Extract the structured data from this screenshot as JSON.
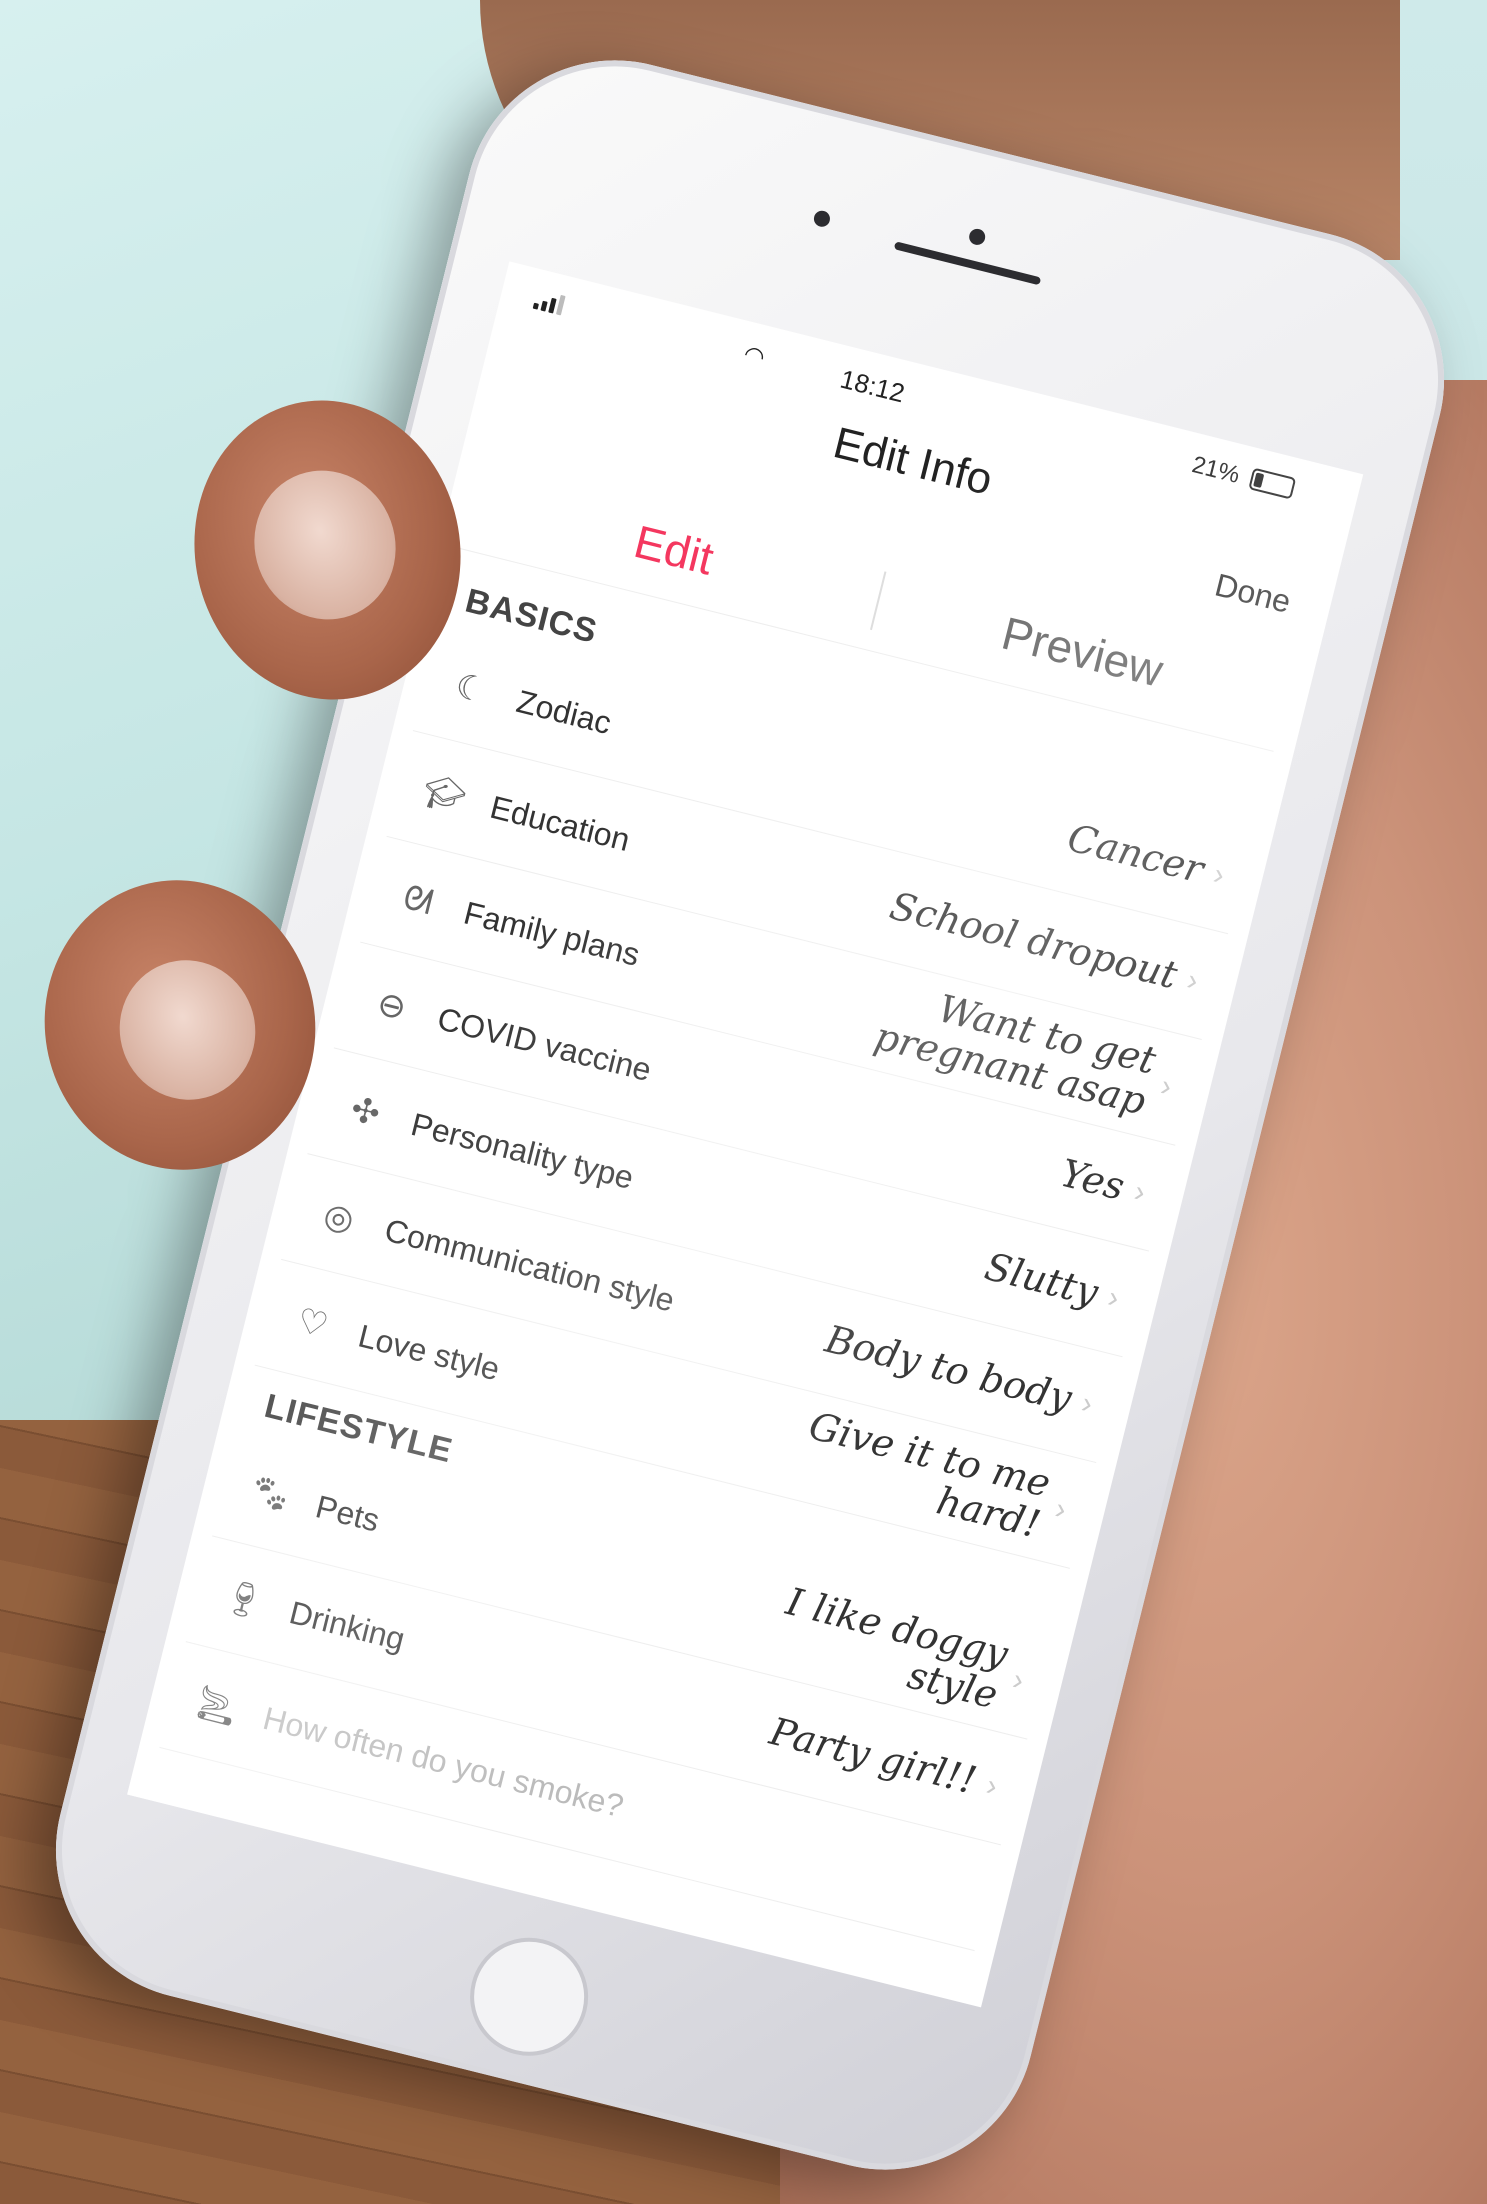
{
  "status_bar": {
    "time": "18:12",
    "battery": "21%"
  },
  "nav": {
    "title": "Edit Info",
    "done_label": "Done"
  },
  "tabs": [
    {
      "label": "Edit",
      "active": true
    },
    {
      "label": "Preview",
      "active": false
    }
  ],
  "sections": {
    "basics": {
      "title": "BASICS",
      "rows": [
        {
          "icon": "moon-icon",
          "label": "Zodiac",
          "value": "Cancer"
        },
        {
          "icon": "graduation-cap-icon",
          "label": "Education",
          "value": "School dropout"
        },
        {
          "icon": "stork-icon",
          "label": "Family plans",
          "value": "Want to get pregnant asap"
        },
        {
          "icon": "vaccine-icon",
          "label": "COVID vaccine",
          "value": "Yes"
        },
        {
          "icon": "puzzle-icon",
          "label": "Personality type",
          "value": "Slutty"
        },
        {
          "icon": "chat-bubble-icon",
          "label": "Communication style",
          "value": "Body to body"
        },
        {
          "icon": "heart-bubble-icon",
          "label": "Love style",
          "value": "Give it to me hard!"
        }
      ]
    },
    "lifestyle": {
      "title": "LIFESTYLE",
      "rows": [
        {
          "icon": "paw-icon",
          "label": "Pets",
          "value": "I like doggy style"
        },
        {
          "icon": "wine-glass-icon",
          "label": "Drinking",
          "value": "Party girl!!"
        },
        {
          "icon": "smoking-icon",
          "label": "How often do you smoke?",
          "value": ""
        }
      ]
    }
  },
  "colors": {
    "accent": "#f4375f",
    "text": "#333333",
    "divider": "#eeeeee"
  }
}
